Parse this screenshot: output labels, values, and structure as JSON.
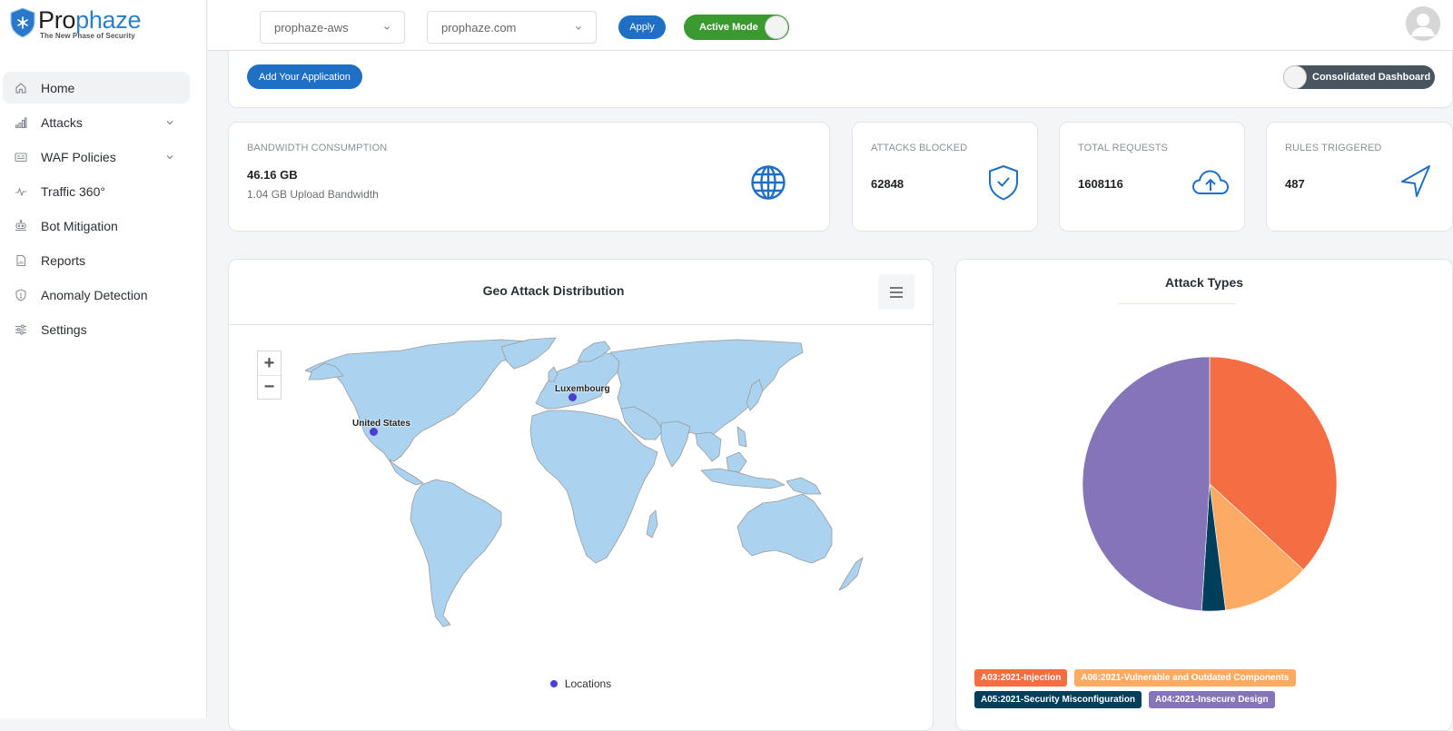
{
  "brand": {
    "name_part1": "Pro",
    "name_part2": "phaze",
    "tagline": "The New Phase of Security"
  },
  "sidebar": {
    "items": [
      {
        "label": "Home",
        "icon": "home-icon",
        "active": true,
        "expandable": false
      },
      {
        "label": "Attacks",
        "icon": "bar-chart-icon",
        "active": false,
        "expandable": true
      },
      {
        "label": "WAF Policies",
        "icon": "policy-card-icon",
        "active": false,
        "expandable": true
      },
      {
        "label": "Traffic 360°",
        "icon": "pulse-icon",
        "active": false,
        "expandable": false
      },
      {
        "label": "Bot Mitigation",
        "icon": "robot-icon",
        "active": false,
        "expandable": false
      },
      {
        "label": "Reports",
        "icon": "report-file-icon",
        "active": false,
        "expandable": false
      },
      {
        "label": "Anomaly Detection",
        "icon": "shield-alert-icon",
        "active": false,
        "expandable": false
      },
      {
        "label": "Settings",
        "icon": "sliders-icon",
        "active": false,
        "expandable": false
      }
    ]
  },
  "topbar": {
    "account_select": "prophaze-aws",
    "domain_select": "prophaze.com",
    "apply_label": "Apply",
    "active_mode_label": "Active Mode",
    "active_mode_on": true
  },
  "app_bar": {
    "add_app_label": "Add Your Application",
    "consolidated_label": "Consolidated Dashboard",
    "consolidated_on": false
  },
  "stats": {
    "bandwidth": {
      "label": "BANDWIDTH CONSUMPTION",
      "value": "46.16 GB",
      "sub": "1.04 GB Upload Bandwidth",
      "icon": "globe-icon"
    },
    "attacks_blocked": {
      "label": "ATTACKS BLOCKED",
      "value": "62848",
      "icon": "shield-check-icon"
    },
    "total_requests": {
      "label": "TOTAL REQUESTS",
      "value": "1608116",
      "icon": "cloud-upload-icon"
    },
    "rules_triggered": {
      "label": "RULES TRIGGERED",
      "value": "487",
      "icon": "send-icon"
    }
  },
  "geo": {
    "title": "Geo Attack Distribution",
    "zoom_in": "+",
    "zoom_out": "−",
    "legend_label": "Locations",
    "locations": [
      {
        "name": "United States"
      },
      {
        "name": "Luxembourg"
      }
    ],
    "land_color": "#abd3f0",
    "border_color": "#9a9a9a",
    "marker_color": "#4b3fce"
  },
  "chart_data": {
    "type": "pie",
    "title": "Attack Types",
    "categories": [
      "A03:2021-Injection",
      "A06:2021-Vulnerable and Outdated Components",
      "A05:2021-Security Misconfiguration",
      "A04:2021-Insecure Design"
    ],
    "values": [
      36.8,
      11.2,
      3.0,
      49.0
    ],
    "unit": "percent (estimated)",
    "colors": [
      "#f56d43",
      "#fdab63",
      "#003f5c",
      "#8574b8"
    ],
    "start": "top",
    "direction": "clockwise",
    "legend_position": "bottom-left"
  },
  "legend_pills": [
    {
      "label": "A03:2021-Injection",
      "color": "#f56d43"
    },
    {
      "label": "A06:2021-Vulnerable and Outdated Components",
      "color": "#fdab63"
    },
    {
      "label": "A05:2021-Security Misconfiguration",
      "color": "#003f5c"
    },
    {
      "label": "A04:2021-Insecure Design",
      "color": "#8574b8"
    }
  ]
}
